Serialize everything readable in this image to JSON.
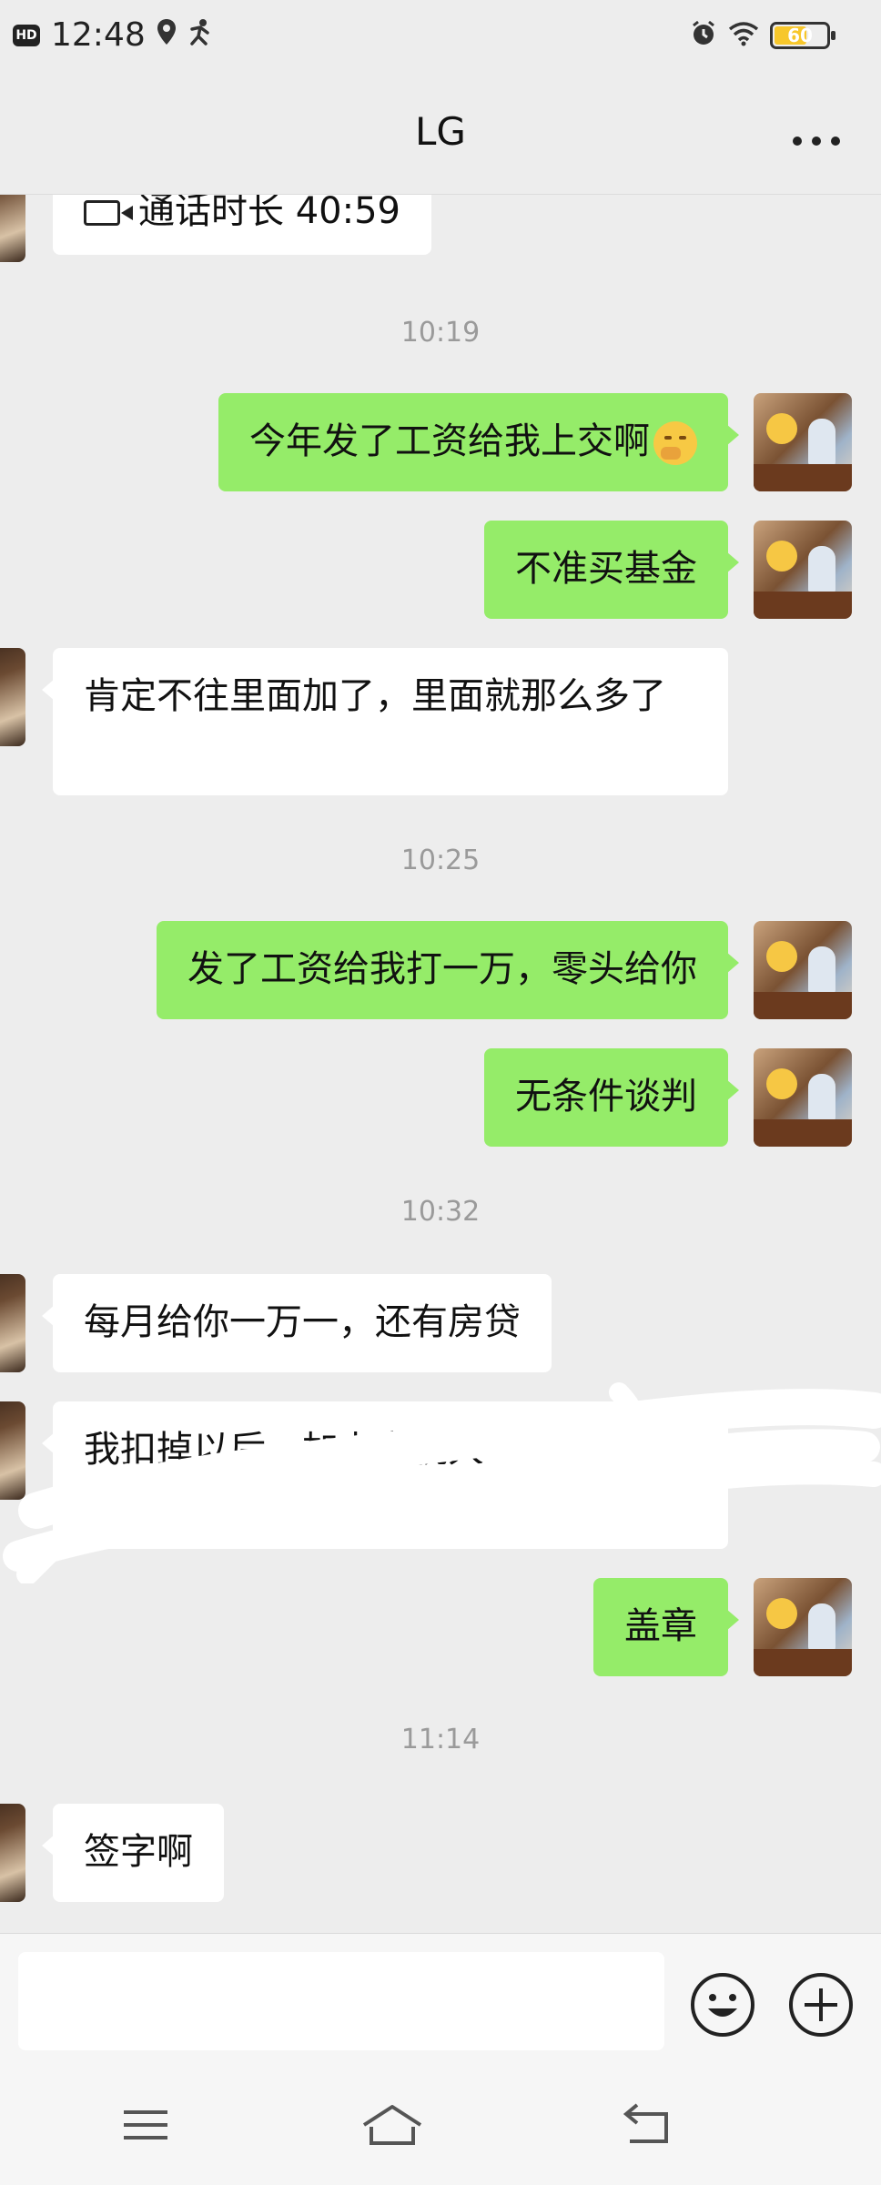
{
  "status_bar": {
    "hd_badge": "HD",
    "time": "12:48",
    "battery_level": "60"
  },
  "header": {
    "title": "LG",
    "more_label": "···"
  },
  "messages": [
    {
      "id": "m0",
      "side": "left",
      "type": "call",
      "text": "通话时长 40:59"
    },
    {
      "id": "t1",
      "type": "timestamp",
      "text": "10:19"
    },
    {
      "id": "m1",
      "side": "right",
      "text": "今年发了工资给我上交啊",
      "emoji": "thinking-face"
    },
    {
      "id": "m2",
      "side": "right",
      "text": "不准买基金"
    },
    {
      "id": "m3",
      "side": "left",
      "text": "肯定不往里面加了，里面就那么多了"
    },
    {
      "id": "t2",
      "type": "timestamp",
      "text": "10:25"
    },
    {
      "id": "m4",
      "side": "right",
      "text": "发了工资给我打一万，零头给你"
    },
    {
      "id": "m5",
      "side": "right",
      "text": "无条件谈判"
    },
    {
      "id": "t3",
      "type": "timestamp",
      "text": "10:32"
    },
    {
      "id": "m6",
      "side": "left",
      "text": "每月给你一万一，还有房贷"
    },
    {
      "id": "m7",
      "side": "left",
      "text": "我扣掉以后，加上交税大",
      "redacted": true
    },
    {
      "id": "m8",
      "side": "right",
      "text": "盖章"
    },
    {
      "id": "t4",
      "type": "timestamp",
      "text": "11:14"
    },
    {
      "id": "m9",
      "side": "left",
      "text": "签字啊"
    }
  ],
  "input_bar": {
    "value": "",
    "emoji_button_icon": "smiley-icon",
    "plus_button_icon": "plus-circle-icon"
  },
  "nav_bar": {
    "icons": [
      "menu-icon",
      "home-icon",
      "back-icon"
    ]
  },
  "colors": {
    "sent_bubble": "#95ec69",
    "received_bubble": "#ffffff",
    "background": "#ededed",
    "timestamp": "#9a9a9a"
  }
}
